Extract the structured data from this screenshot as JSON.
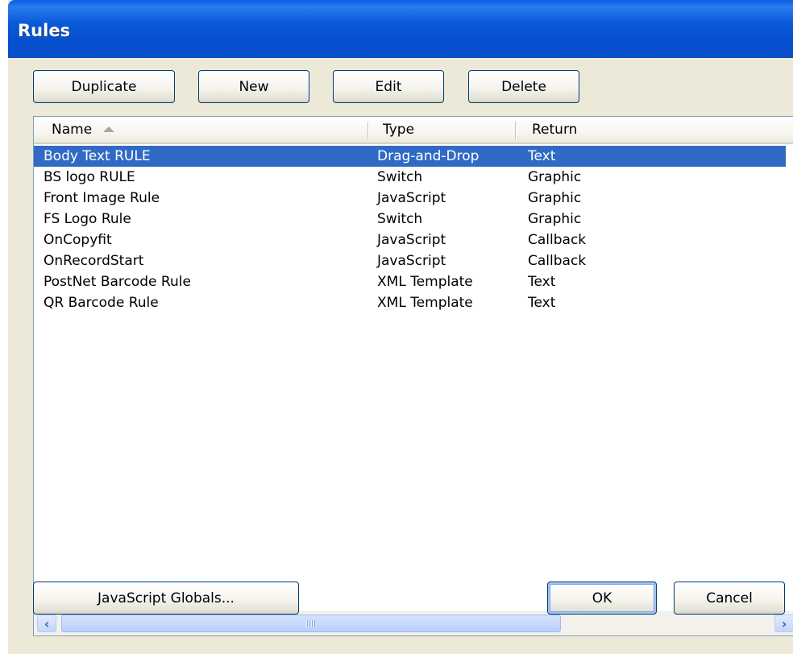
{
  "window": {
    "title": "Rules"
  },
  "toolbar": {
    "duplicate_label": "Duplicate",
    "new_label": "New",
    "edit_label": "Edit",
    "delete_label": "Delete"
  },
  "list": {
    "columns": [
      {
        "label": "Name",
        "sorted": "ascending"
      },
      {
        "label": "Type"
      },
      {
        "label": "Return"
      }
    ],
    "rows": [
      {
        "name": "Body Text RULE",
        "type": "Drag-and-Drop",
        "return": "Text",
        "selected": true
      },
      {
        "name": "BS logo RULE",
        "type": "Switch",
        "return": "Graphic"
      },
      {
        "name": "Front Image Rule",
        "type": "JavaScript",
        "return": "Graphic"
      },
      {
        "name": "FS Logo Rule",
        "type": "Switch",
        "return": "Graphic"
      },
      {
        "name": "OnCopyfit",
        "type": "JavaScript",
        "return": "Callback"
      },
      {
        "name": "OnRecordStart",
        "type": "JavaScript",
        "return": "Callback"
      },
      {
        "name": "PostNet Barcode Rule",
        "type": "XML Template",
        "return": "Text"
      },
      {
        "name": "QR Barcode Rule",
        "type": "XML Template",
        "return": "Text"
      }
    ]
  },
  "scrollbar": {
    "left_icon": "scroll-left-icon",
    "right_icon": "scroll-right-icon"
  },
  "footer": {
    "globals_label": "JavaScript Globals...",
    "ok_label": "OK",
    "cancel_label": "Cancel"
  },
  "colors": {
    "titlebar": "#0a59d8",
    "selection": "#316ac5",
    "dialog_bg": "#ece9d8"
  }
}
